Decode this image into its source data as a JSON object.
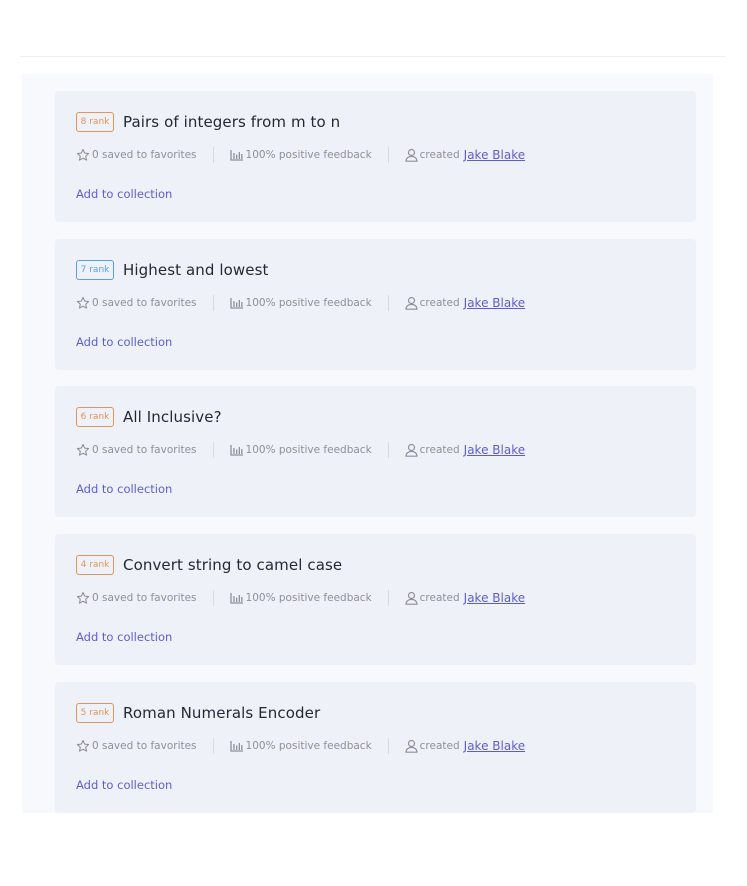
{
  "tasks": [
    {
      "rank": "8 rank",
      "badge_color": "#e0955a",
      "title": "Pairs of integers from m to n",
      "favorites": "0 saved to favorites",
      "feedback": "100% positive feedback",
      "created_label": "created",
      "author": "Jake Blake",
      "add_label": "Add to collection"
    },
    {
      "rank": "7 rank",
      "badge_color": "#5aa0e6",
      "title": "Highest and lowest",
      "favorites": "0 saved to favorites",
      "feedback": "100% positive feedback",
      "created_label": "created",
      "author": "Jake Blake",
      "add_label": "Add to collection"
    },
    {
      "rank": "6 rank",
      "badge_color": "#e0955a",
      "title": "All Inclusive?",
      "favorites": "0 saved to favorites",
      "feedback": "100% positive feedback",
      "created_label": "created",
      "author": "Jake Blake",
      "add_label": "Add to collection"
    },
    {
      "rank": "4 rank",
      "badge_color": "#e0955a",
      "title": "Convert string to camel case",
      "favorites": "0 saved to favorites",
      "feedback": "100% positive feedback",
      "created_label": "created",
      "author": "Jake Blake",
      "add_label": "Add to collection"
    },
    {
      "rank": "5 rank",
      "badge_color": "#e0955a",
      "title": "Roman Numerals Encoder",
      "favorites": "0 saved to favorites",
      "feedback": "100% positive feedback",
      "created_label": "created",
      "author": "Jake Blake",
      "add_label": "Add to collection"
    }
  ],
  "icons": {
    "favorites": "star-icon",
    "feedback": "bar-chart-icon",
    "author": "user-icon"
  },
  "colors": {
    "accent": "#5e5ec9",
    "card_bg": "#eff1f8",
    "muted_text": "#8e8f9a"
  }
}
